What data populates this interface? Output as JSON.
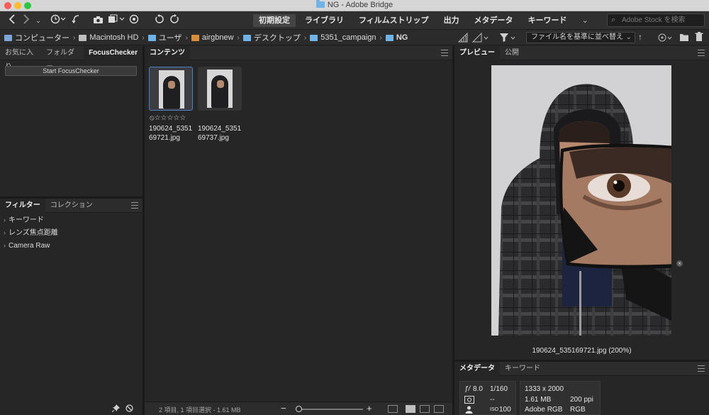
{
  "window": {
    "title": "NG - Adobe Bridge"
  },
  "toolbar": {
    "workspaces": [
      {
        "label": "初期設定",
        "active": true
      },
      {
        "label": "ライブラリ",
        "active": false
      },
      {
        "label": "フィルムストリップ",
        "active": false
      },
      {
        "label": "出力",
        "active": false
      },
      {
        "label": "メタデータ",
        "active": false
      },
      {
        "label": "キーワード",
        "active": false
      }
    ],
    "more_icon": "chevron-down-icon",
    "search_placeholder": "Adobe Stock を検索"
  },
  "path": {
    "crumbs": [
      "コンピューター",
      "Macintosh HD",
      "ユーザ",
      "airgbnew",
      "デスクトップ",
      "5351_campaign",
      "NG"
    ],
    "sort_label": "ファイル名を基準に並べ替え"
  },
  "left_top_panel": {
    "tabs": [
      "お気に入り",
      "フォルダー",
      "FocusChecker"
    ],
    "button_label": "Start FocusChecker"
  },
  "filter_panel": {
    "tabs": [
      "フィルター",
      "コレクション"
    ],
    "items": [
      "キーワード",
      "レンズ焦点距離",
      "Camera Raw"
    ]
  },
  "content": {
    "tab": "コンテンツ",
    "items": [
      {
        "name": "190624_535169721.jpg",
        "line1": "190624_5351",
        "line2": "69721.jpg",
        "selected": true
      },
      {
        "name": "190624_535169737.jpg",
        "line1": "190624_5351",
        "line2": "69737.jpg",
        "selected": false
      }
    ],
    "rating_text": "⦸☆☆☆☆☆",
    "status": "2 項目, 1 項目選択 - 1.61 MB",
    "zoom_minus": "−",
    "zoom_plus": "+",
    "zoom_level": 0.0
  },
  "preview": {
    "tabs": [
      "プレビュー",
      "公開"
    ],
    "caption": "190624_535169721.jpg (200%)"
  },
  "metadata": {
    "tabs": [
      "メタデータ",
      "キーワード"
    ],
    "fstop_label": "ƒ/",
    "fstop": "8.0",
    "shutter": "1/160",
    "flash_value": "--",
    "iso_label": "ISO",
    "iso": "100",
    "dimensions": "1333 x 2000",
    "filesize": "1.61 MB",
    "resolution": "200 ppi",
    "profile": "Adobe RGB",
    "colormode": "RGB"
  }
}
